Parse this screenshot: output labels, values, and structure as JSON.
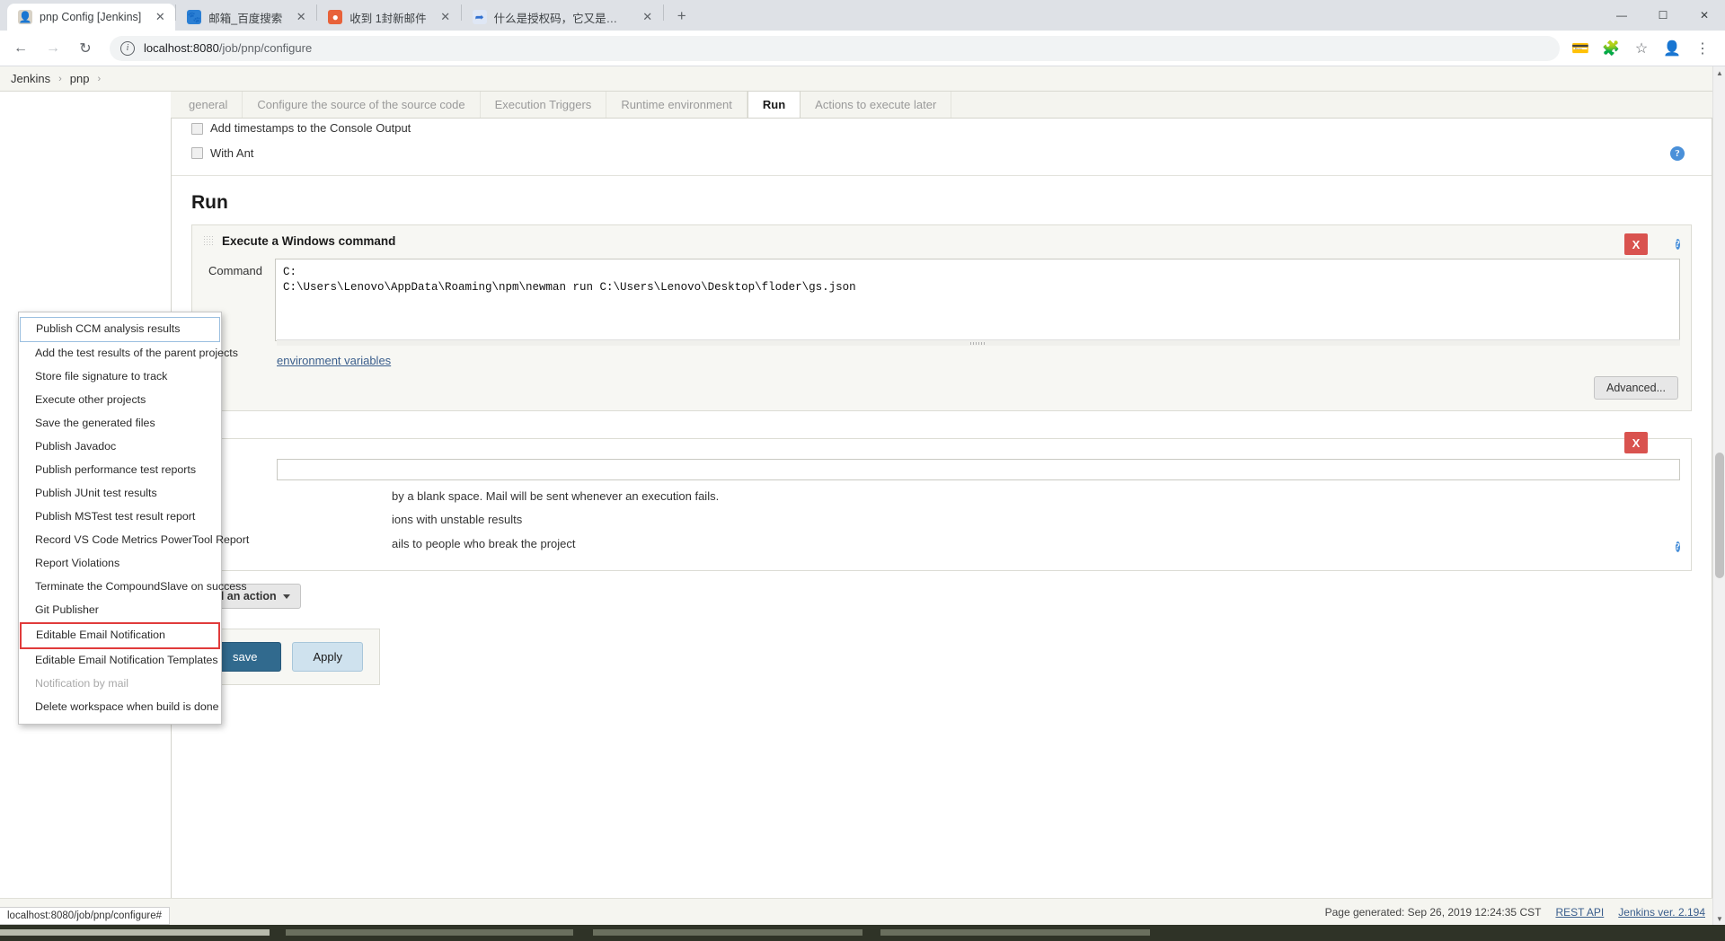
{
  "browser": {
    "tabs": [
      {
        "title": "pnp Config [Jenkins]",
        "favicon": "jenkins-favicon",
        "active": true
      },
      {
        "title": "邮箱_百度搜索",
        "favicon": "baidu-favicon",
        "active": false
      },
      {
        "title": "收到 1封新邮件",
        "favicon": "mail-favicon",
        "active": false
      },
      {
        "title": "什么是授权码，它又是如何设置",
        "favicon": "link-favicon",
        "active": false
      }
    ],
    "new_tab_label": "+",
    "window_controls": {
      "minimize": "—",
      "maximize": "☐",
      "close": "✕"
    },
    "nav": {
      "back": "←",
      "forward": "→",
      "reload": "↻"
    },
    "omnibox": {
      "info_icon": "i",
      "url_host": "localhost:8080",
      "url_path": "/job/pnp/configure",
      "full_url": "localhost:8080/job/pnp/configure"
    },
    "toolbar_right": {
      "payments": "card-icon",
      "extensions": "puzzle-icon",
      "bookmark": "star-icon",
      "profile": "avatar-icon",
      "menu": "kebab-menu-icon"
    }
  },
  "breadcrumb": {
    "items": [
      "Jenkins",
      "pnp"
    ],
    "separator": "›"
  },
  "config_tabs": [
    {
      "label": "general",
      "active": false
    },
    {
      "label": "Configure the source of the source code",
      "active": false
    },
    {
      "label": "Execution Triggers",
      "active": false
    },
    {
      "label": "Runtime environment",
      "active": false
    },
    {
      "label": "Run",
      "active": true
    },
    {
      "label": "Actions to execute later",
      "active": false
    }
  ],
  "env_section": {
    "timestamps_label": "Add timestamps to the Console Output",
    "with_ant_label": "With Ant"
  },
  "run_section": {
    "title": "Run",
    "builder": {
      "heading": "Execute a Windows command",
      "delete_label": "X",
      "help_label": "?",
      "command_label": "Command",
      "command_value": "C:\nC:\\Users\\Lenovo\\AppData\\Roaming\\npm\\newman run C:\\Users\\Lenovo\\Desktop\\floder\\gs.json",
      "hint_link": "environment variables",
      "advanced_label": "Advanced..."
    },
    "post_build": {
      "delete_label": "X",
      "help_label": "?",
      "line1": "by a blank space. Mail will be sent whenever an execution fails.",
      "line2": "ions with unstable results",
      "line3": "ails to people who break the project"
    },
    "add_action_label": "Add an action",
    "save_label": "save",
    "apply_label": "Apply"
  },
  "dropdown": {
    "items": [
      {
        "label": "Publish CCM analysis results",
        "state": "selected"
      },
      {
        "label": "Add the test results of the parent projects",
        "state": "normal"
      },
      {
        "label": "Store file signature to track",
        "state": "normal"
      },
      {
        "label": "Execute other projects",
        "state": "normal"
      },
      {
        "label": "Save the generated files",
        "state": "normal"
      },
      {
        "label": "Publish Javadoc",
        "state": "normal"
      },
      {
        "label": "Publish performance test reports",
        "state": "normal"
      },
      {
        "label": "Publish JUnit test results",
        "state": "normal"
      },
      {
        "label": "Publish MSTest test result report",
        "state": "normal"
      },
      {
        "label": "Record VS Code Metrics PowerTool Report",
        "state": "normal"
      },
      {
        "label": "Report Violations",
        "state": "normal"
      },
      {
        "label": "Terminate the CompoundSlave on success",
        "state": "normal"
      },
      {
        "label": "Git Publisher",
        "state": "normal"
      },
      {
        "label": "Editable Email Notification",
        "state": "highlighted"
      },
      {
        "label": "Editable Email Notification Templates",
        "state": "normal"
      },
      {
        "label": "Notification by mail",
        "state": "disabled"
      },
      {
        "label": "Delete workspace when build is done",
        "state": "normal"
      }
    ]
  },
  "footer": {
    "page_generated": "Page generated: Sep 26, 2019 12:24:35 CST",
    "rest_api": "REST API",
    "version": "Jenkins ver. 2.194"
  },
  "status_bubble": {
    "text": "localhost:8080/job/pnp/configure#"
  },
  "colors": {
    "accent": "#316a8e",
    "danger": "#d9534f",
    "highlight": "#e03b3b",
    "help": "#4a90d9",
    "link": "#3a5e8c"
  }
}
